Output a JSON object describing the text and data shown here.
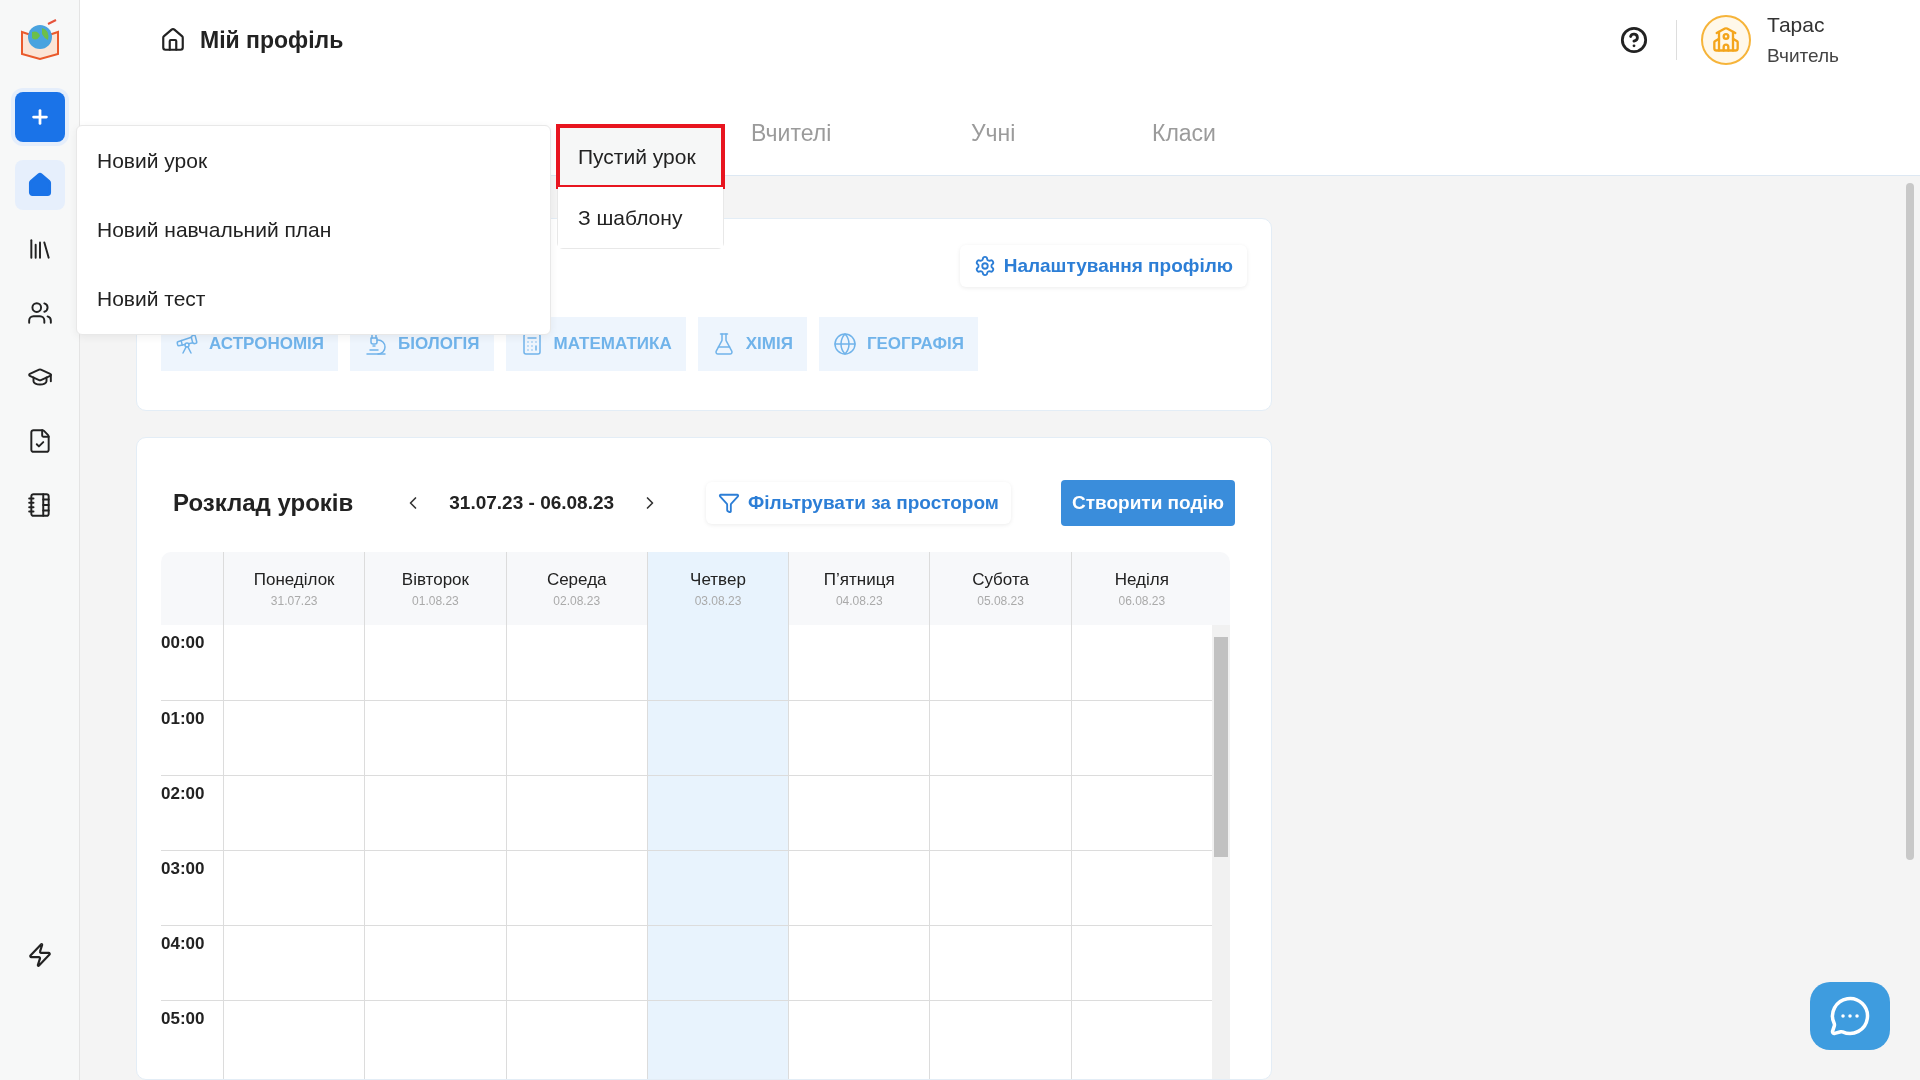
{
  "header": {
    "title": "Мій профіль"
  },
  "user": {
    "name": "Тарас",
    "role": "Вчитель"
  },
  "nav_items": [
    {
      "selected": true
    },
    {
      "selected": false
    },
    {
      "selected": false
    },
    {
      "selected": false
    },
    {
      "selected": false
    },
    {
      "selected": false
    }
  ],
  "create_menu": {
    "items": [
      {
        "label": "Новий урок"
      },
      {
        "label": "Новий навчальний план"
      },
      {
        "label": "Новий тест"
      }
    ]
  },
  "submenu": {
    "items": [
      {
        "label": "Пустий урок",
        "selected": true
      },
      {
        "label": "З шаблону",
        "selected": false
      }
    ]
  },
  "tabs": [
    {
      "label": "Вчителі",
      "selected": false
    },
    {
      "label": "Учні",
      "selected": false
    },
    {
      "label": "Класи",
      "selected": false
    }
  ],
  "profile": {
    "settings_button": "Налаштування профілю",
    "subjects": [
      {
        "label": "АСТРОНОМІЯ"
      },
      {
        "label": "БІОЛОГІЯ"
      },
      {
        "label": "МАТЕМАТИКА"
      },
      {
        "label": "ХІМІЯ"
      },
      {
        "label": "ГЕОГРАФІЯ"
      }
    ]
  },
  "schedule": {
    "title": "Розклад уроків",
    "range": "31.07.23 - 06.08.23",
    "filter_button": "Фільтрувати за простором",
    "create_button": "Створити подію",
    "days": [
      {
        "name": "Понеділок",
        "date": "31.07.23",
        "selected": false
      },
      {
        "name": "Вівторок",
        "date": "01.08.23",
        "selected": false
      },
      {
        "name": "Середа",
        "date": "02.08.23",
        "selected": false
      },
      {
        "name": "Четвер",
        "date": "03.08.23",
        "selected": true
      },
      {
        "name": "П’ятниця",
        "date": "04.08.23",
        "selected": false
      },
      {
        "name": "Субота",
        "date": "05.08.23",
        "selected": false
      },
      {
        "name": "Неділя",
        "date": "06.08.23",
        "selected": false
      }
    ],
    "times": [
      "00:00",
      "01:00",
      "02:00",
      "03:00",
      "04:00",
      "05:00"
    ]
  }
}
